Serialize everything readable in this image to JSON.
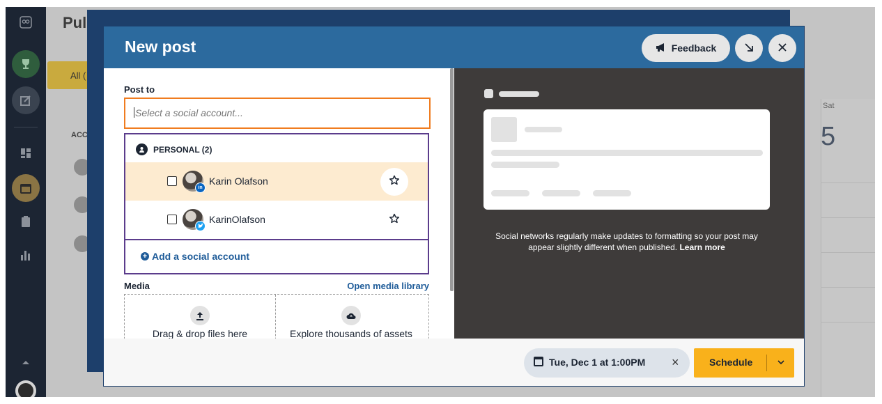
{
  "background_app": {
    "page_title_partial": "Pul",
    "filter_partial": "All (",
    "accounts_label_partial": "ACC",
    "calendar": {
      "day_label": "Sat",
      "day_number": "5"
    }
  },
  "modal": {
    "title": "New post",
    "feedback_label": "Feedback",
    "post_to": {
      "label": "Post to",
      "input_placeholder": "Select a social account...",
      "group_label": "PERSONAL (2)",
      "accounts": [
        {
          "name": "Karin Olafson",
          "network": "linkedin"
        },
        {
          "name": "KarinOlafson",
          "network": "twitter"
        }
      ],
      "add_account_label": "Add a social account"
    },
    "media": {
      "label": "Media",
      "library_link": "Open media library",
      "upload_label": "Drag & drop files here",
      "explore_label": "Explore thousands of assets"
    },
    "preview": {
      "note_text": "Social networks regularly make updates to formatting so your post may appear slightly different when published.",
      "learn_more": "Learn more"
    },
    "footer": {
      "schedule_date": "Tue, Dec 1 at 1:00PM",
      "schedule_label": "Schedule"
    }
  },
  "colors": {
    "header_blue": "#2c6a9e",
    "focus_orange": "#f07c1f",
    "list_border_purple": "#5b3c8c",
    "link_blue": "#1f5c99",
    "schedule_yellow": "#f9b11b",
    "preview_dark": "#3e3b3a",
    "highlight_row": "#fdebd0"
  }
}
